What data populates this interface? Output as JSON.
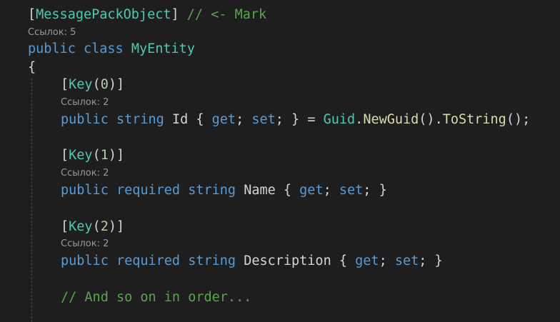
{
  "editor": {
    "line_attr": {
      "open": "[",
      "name": "MessagePackObject",
      "close": "]",
      "comment": "// <- Mark"
    },
    "lens_class": "Ссылок: 5",
    "class_decl": {
      "kw1": "public",
      "kw2": "class",
      "name": "MyEntity"
    },
    "open_brace": "{",
    "key0": {
      "open": "[",
      "name": "Key",
      "popen": "(",
      "num": "0",
      "pclose": ")",
      "close": "]"
    },
    "lens_key0": "Ссылок: 2",
    "prop_id": {
      "kw1": "public",
      "kw2": "string",
      "name": "Id",
      "ob": "{",
      "get": "get",
      "semi1": ";",
      "set": "set",
      "semi2": ";",
      "cb": "}",
      "eq": "=",
      "guid": "Guid",
      "dot1": ".",
      "newguid": "NewGuid",
      "par1": "()",
      "dot2": ".",
      "tostring": "ToString",
      "par2": "();"
    },
    "key1": {
      "open": "[",
      "name": "Key",
      "popen": "(",
      "num": "1",
      "pclose": ")",
      "close": "]"
    },
    "lens_key1": "Ссылок: 2",
    "prop_name": {
      "kw1": "public",
      "kw2": "required",
      "kw3": "string",
      "name": "Name",
      "ob": "{",
      "get": "get",
      "semi1": ";",
      "set": "set",
      "semi2": ";",
      "cb": "}"
    },
    "key2": {
      "open": "[",
      "name": "Key",
      "popen": "(",
      "num": "2",
      "pclose": ")",
      "close": "]"
    },
    "lens_key2": "Ссылок: 2",
    "prop_desc": {
      "kw1": "public",
      "kw2": "required",
      "kw3": "string",
      "name": "Description",
      "ob": "{",
      "get": "get",
      "semi1": ";",
      "set": "set",
      "semi2": ";",
      "cb": "}"
    },
    "comment_end": "// And so on in order..."
  },
  "colors": {
    "background": "#1e1e1e",
    "keyword": "#569cd6",
    "type": "#4ec9b0",
    "method": "#dcdcaa",
    "comment": "#57a64a",
    "text": "#d4d4d4",
    "codelens": "#999999"
  }
}
